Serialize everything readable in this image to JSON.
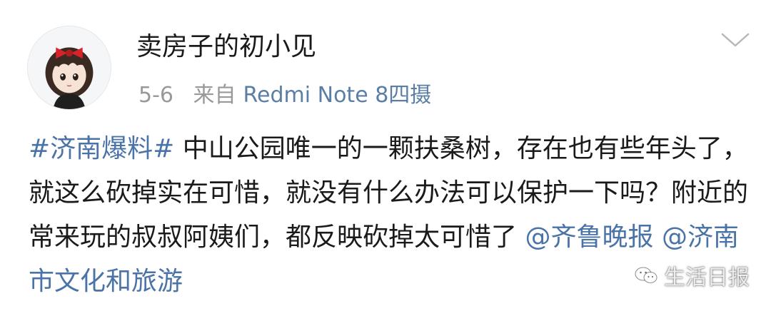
{
  "post": {
    "username": "卖房子的初小见",
    "time": "5-6",
    "source_prefix": "来自",
    "source": "Redmi Note 8四摄",
    "content": {
      "hashtag": "#济南爆料#",
      "body": " 中山公园唯一的一颗扶桑树，存在也有些年头了，就这么砍掉实在可惜，就没有什么办法可以保护一下吗？附近的常来玩的叔叔阿姨们，都反映砍掉太可惜了",
      "mention_1": "@齐鲁晚报",
      "mention_2": "@济南市文化和旅游"
    }
  },
  "icons": {
    "avatar": "avatar-image",
    "more": "chevron-down-icon",
    "watermark_logo": "wechat-logo-icon"
  },
  "watermark": {
    "text": "生活日报"
  },
  "colors": {
    "link": "#4a73a8",
    "source": "#5a7ea6",
    "meta": "#999999",
    "text": "#1a1a1a"
  }
}
